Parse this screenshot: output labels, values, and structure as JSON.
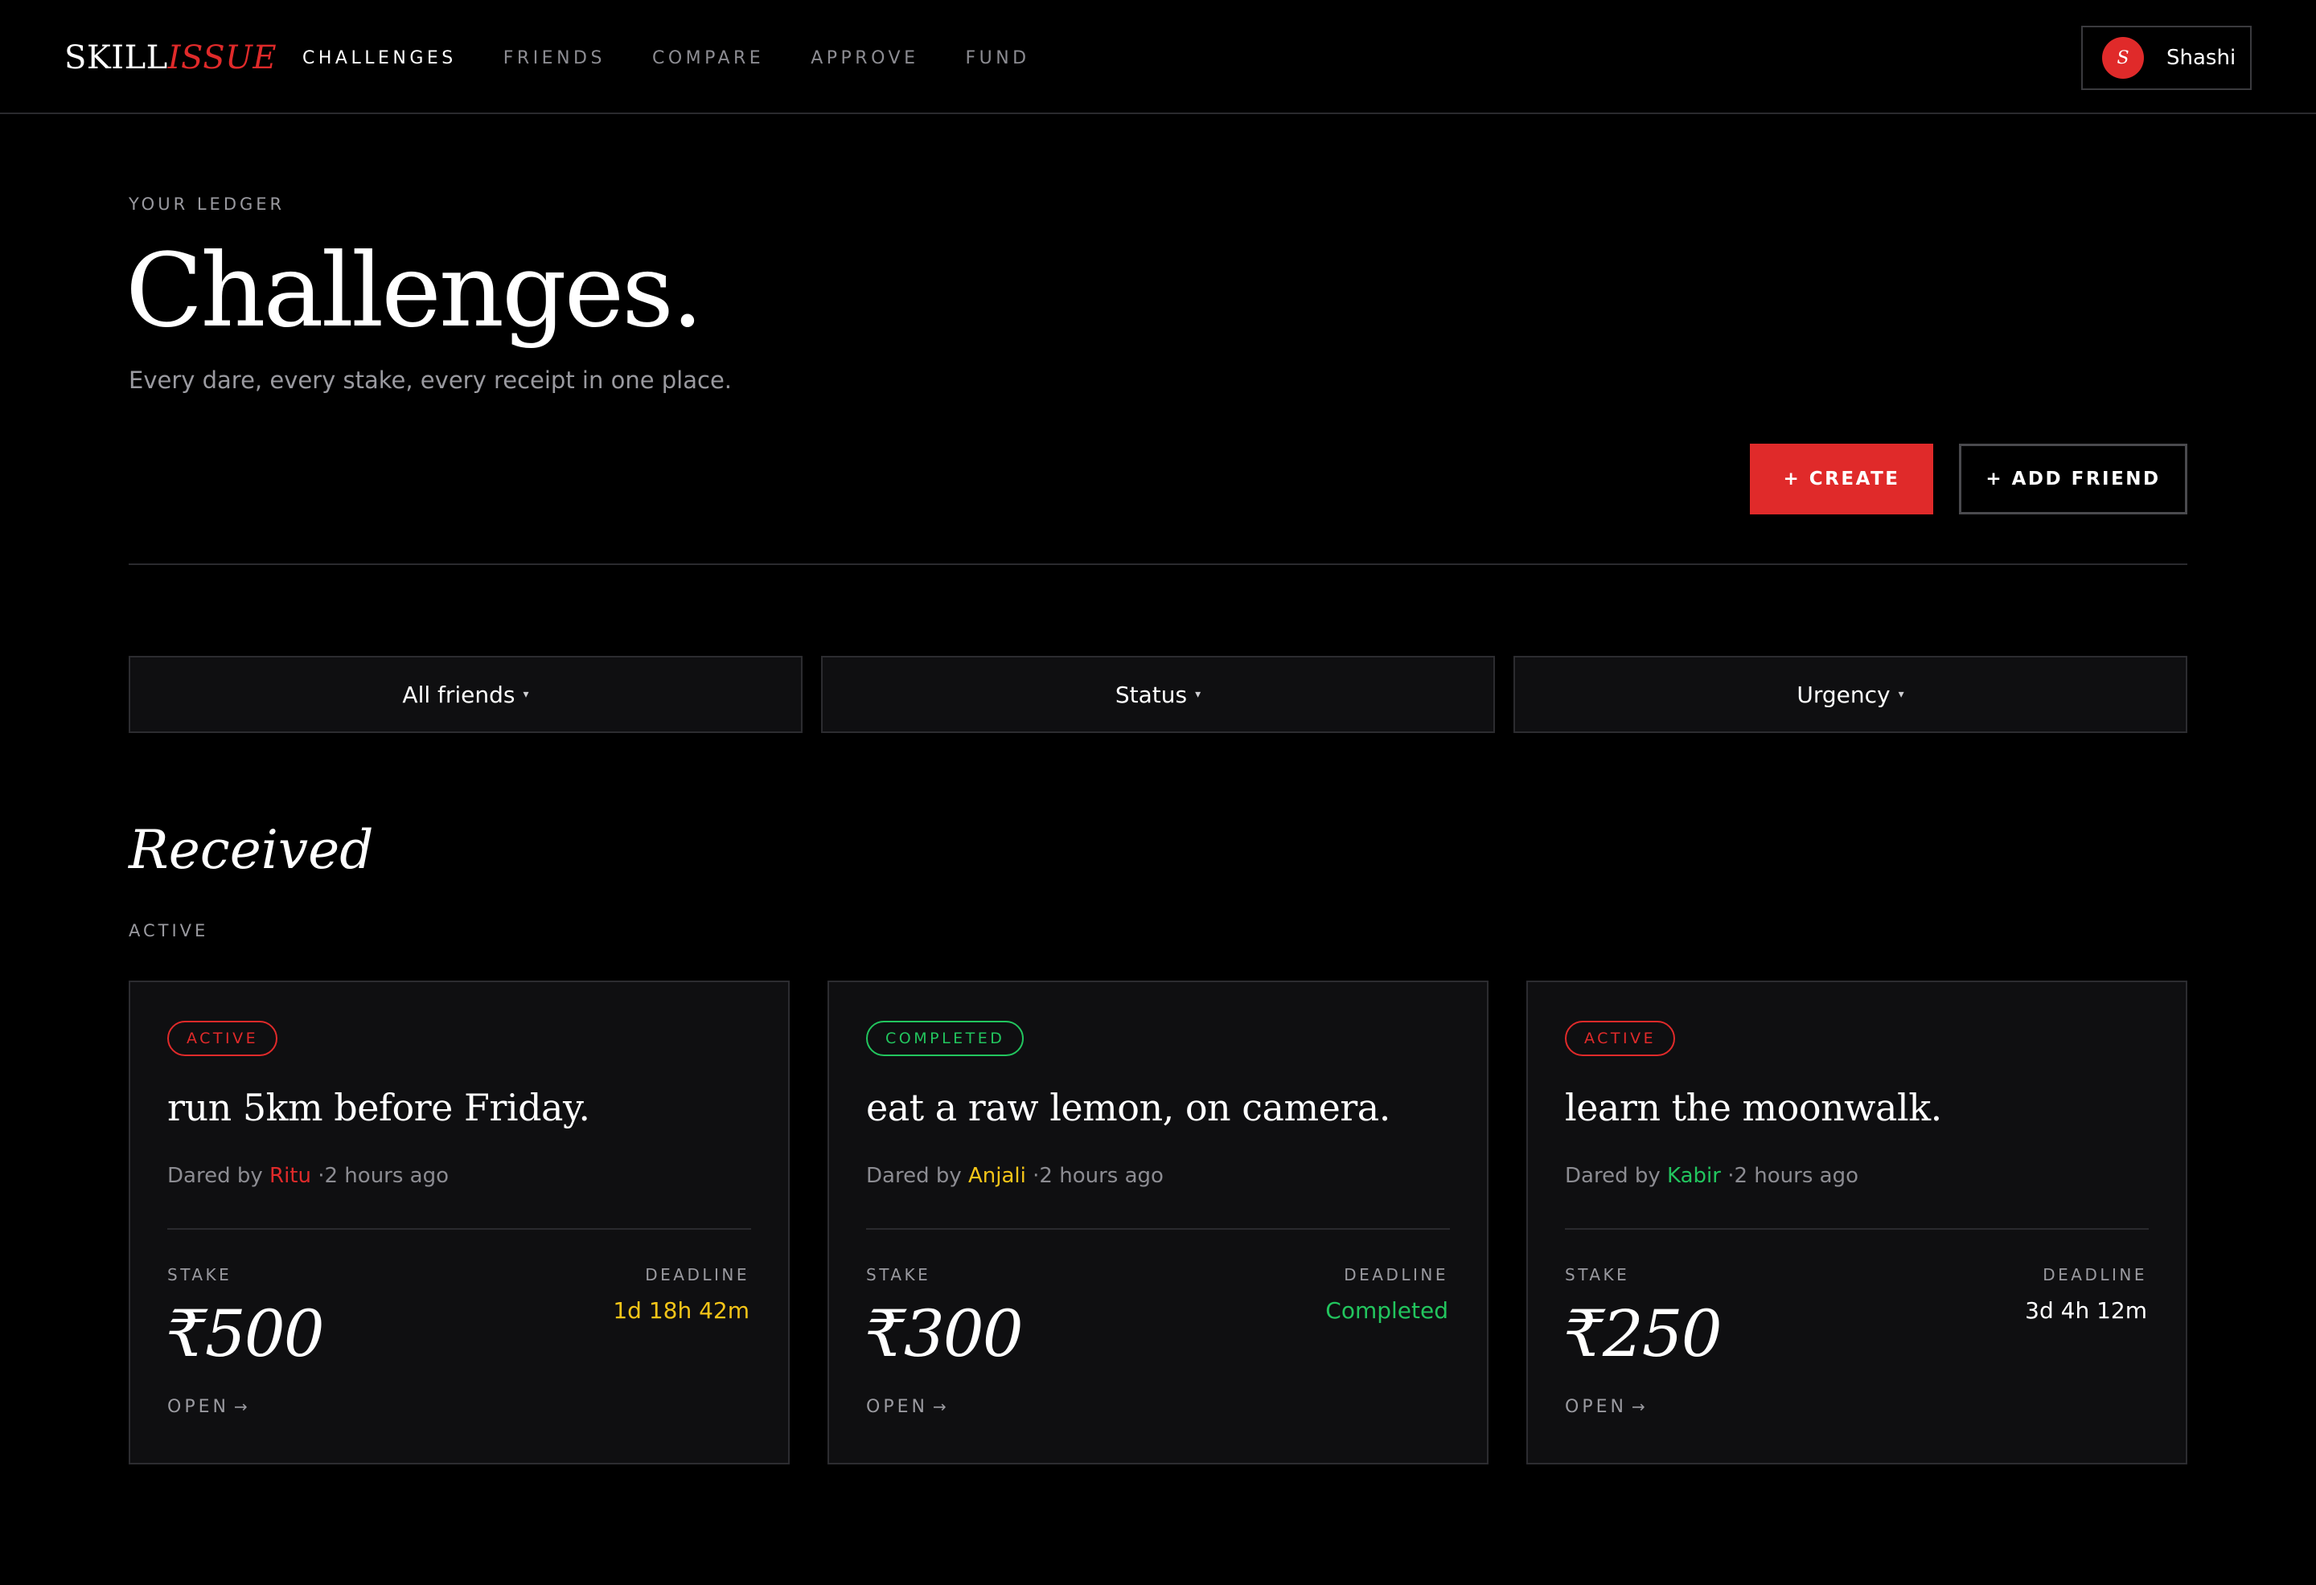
{
  "colors": {
    "accent": "#e02a2a",
    "active": "#e02a2a",
    "completed": "#22c55e",
    "warning": "#f5c518",
    "muted": "#9a9aa0"
  },
  "nav": {
    "logo_part1": "SKILL",
    "logo_part2": "ISSUE",
    "links": [
      "CHALLENGES",
      "FRIENDS",
      "COMPARE",
      "APPROVE",
      "FUND"
    ],
    "active_link": "CHALLENGES",
    "user": {
      "avatar_initial": "S",
      "name": "Shashi"
    }
  },
  "header": {
    "eyebrow": "YOUR LEDGER",
    "title": "Challenges.",
    "subtitle": "Every dare, every stake, every receipt in one place."
  },
  "actions": {
    "create_label": "+ CREATE",
    "add_friend_label": "+ ADD FRIEND"
  },
  "filters": [
    {
      "label": "All friends",
      "caret": "▾"
    },
    {
      "label": "Status",
      "caret": "▾"
    },
    {
      "label": "Urgency",
      "caret": "▾"
    }
  ],
  "section": {
    "title": "Received",
    "subtitle": "ACTIVE"
  },
  "cards": [
    {
      "status": "ACTIVE",
      "status_color": "#e02a2a",
      "title": "run 5km before Friday.",
      "dared_by_prefix": "Dared by",
      "dared_by": "Ritu",
      "dared_by_color": "#e02a2a",
      "time": "·2 hours ago",
      "stake_label": "STAKE",
      "stake": "₹500",
      "deadline_label": "DEADLINE",
      "deadline": "1d 18h 42m",
      "deadline_color": "#f5c518",
      "open_label": "OPEN",
      "open_arrow": "→"
    },
    {
      "status": "COMPLETED",
      "status_color": "#22c55e",
      "title": "eat a raw lemon, on camera.",
      "dared_by_prefix": "Dared by",
      "dared_by": "Anjali",
      "dared_by_color": "#f5c518",
      "time": "·2 hours ago",
      "stake_label": "STAKE",
      "stake": "₹300",
      "deadline_label": "DEADLINE",
      "deadline": "Completed",
      "deadline_color": "#22c55e",
      "open_label": "OPEN",
      "open_arrow": "→"
    },
    {
      "status": "ACTIVE",
      "status_color": "#e02a2a",
      "title": "learn the moonwalk.",
      "dared_by_prefix": "Dared by",
      "dared_by": "Kabir",
      "dared_by_color": "#22c55e",
      "time": "·2 hours ago",
      "stake_label": "STAKE",
      "stake": "₹250",
      "deadline_label": "DEADLINE",
      "deadline": "3d 4h 12m",
      "deadline_color": "#ffffff",
      "open_label": "OPEN",
      "open_arrow": "→"
    }
  ]
}
